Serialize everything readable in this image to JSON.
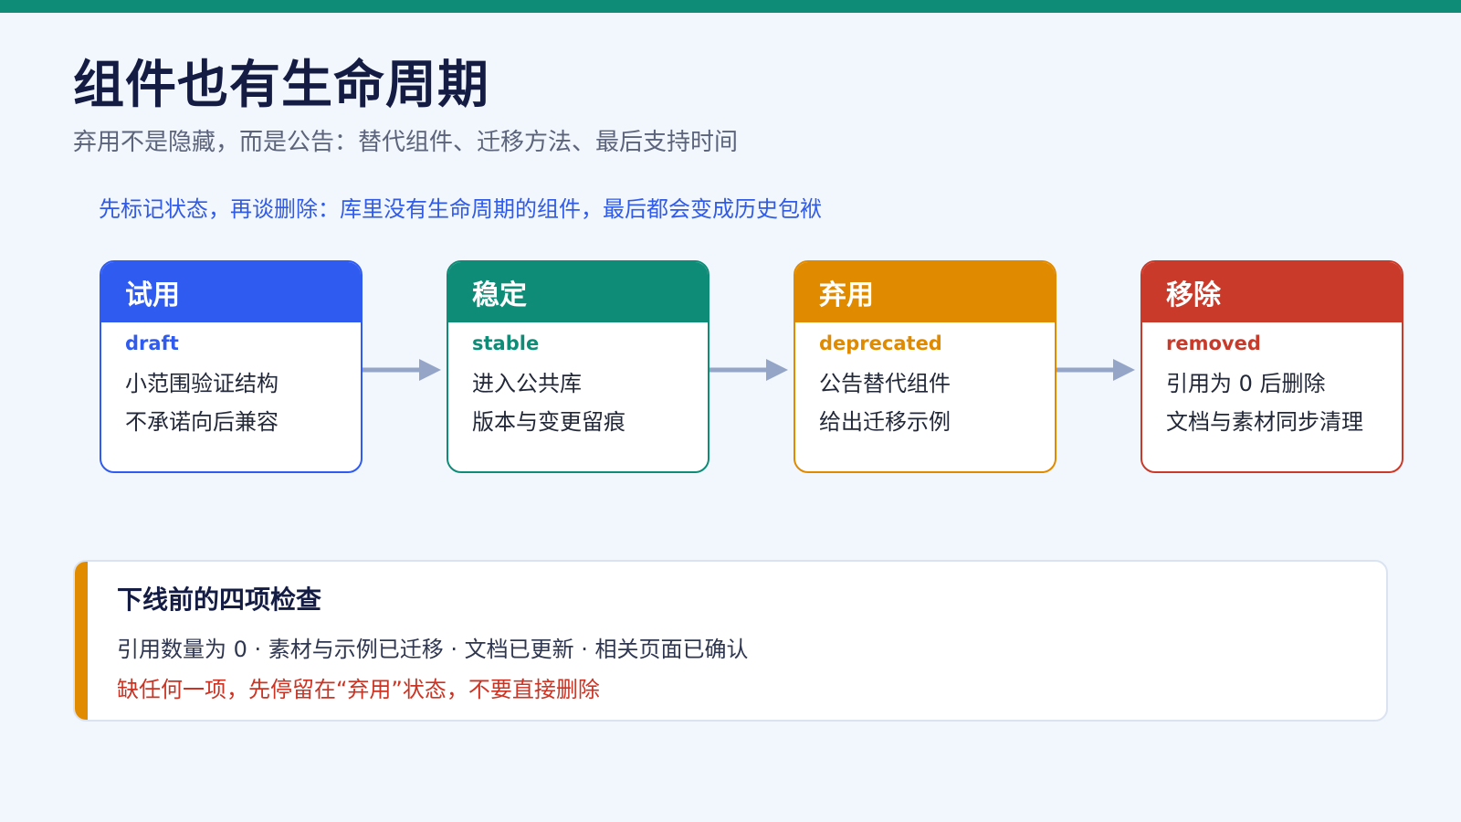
{
  "title": "组件也有生命周期",
  "subtitle": "弃用不是隐藏，而是公告：替代组件、迁移方法、最后支持时间",
  "callout": "先标记状态，再谈删除：库里没有生命周期的组件，最后都会变成历史包袱",
  "stages": [
    {
      "name": "试用",
      "code": "draft",
      "lines": [
        "小范围验证结构",
        "不承诺向后兼容"
      ],
      "color": "#2f5bf0"
    },
    {
      "name": "稳定",
      "code": "stable",
      "lines": [
        "进入公共库",
        "版本与变更留痕"
      ],
      "color": "#0e8c77"
    },
    {
      "name": "弃用",
      "code": "deprecated",
      "lines": [
        "公告替代组件",
        "给出迁移示例"
      ],
      "color": "#e08a00"
    },
    {
      "name": "移除",
      "code": "removed",
      "lines": [
        "引用为 0 后删除",
        "文档与素材同步清理"
      ],
      "color": "#c93a2a"
    }
  ],
  "arrow_color": "#95a5c8",
  "checklist": {
    "title": "下线前的四项检查",
    "items": "引用数量为 0 · 素材与示例已迁移 · 文档已更新 · 相关页面已确认",
    "warning": "缺任何一项，先停留在“弃用”状态，不要直接删除",
    "accent_color": "#e18c00"
  }
}
